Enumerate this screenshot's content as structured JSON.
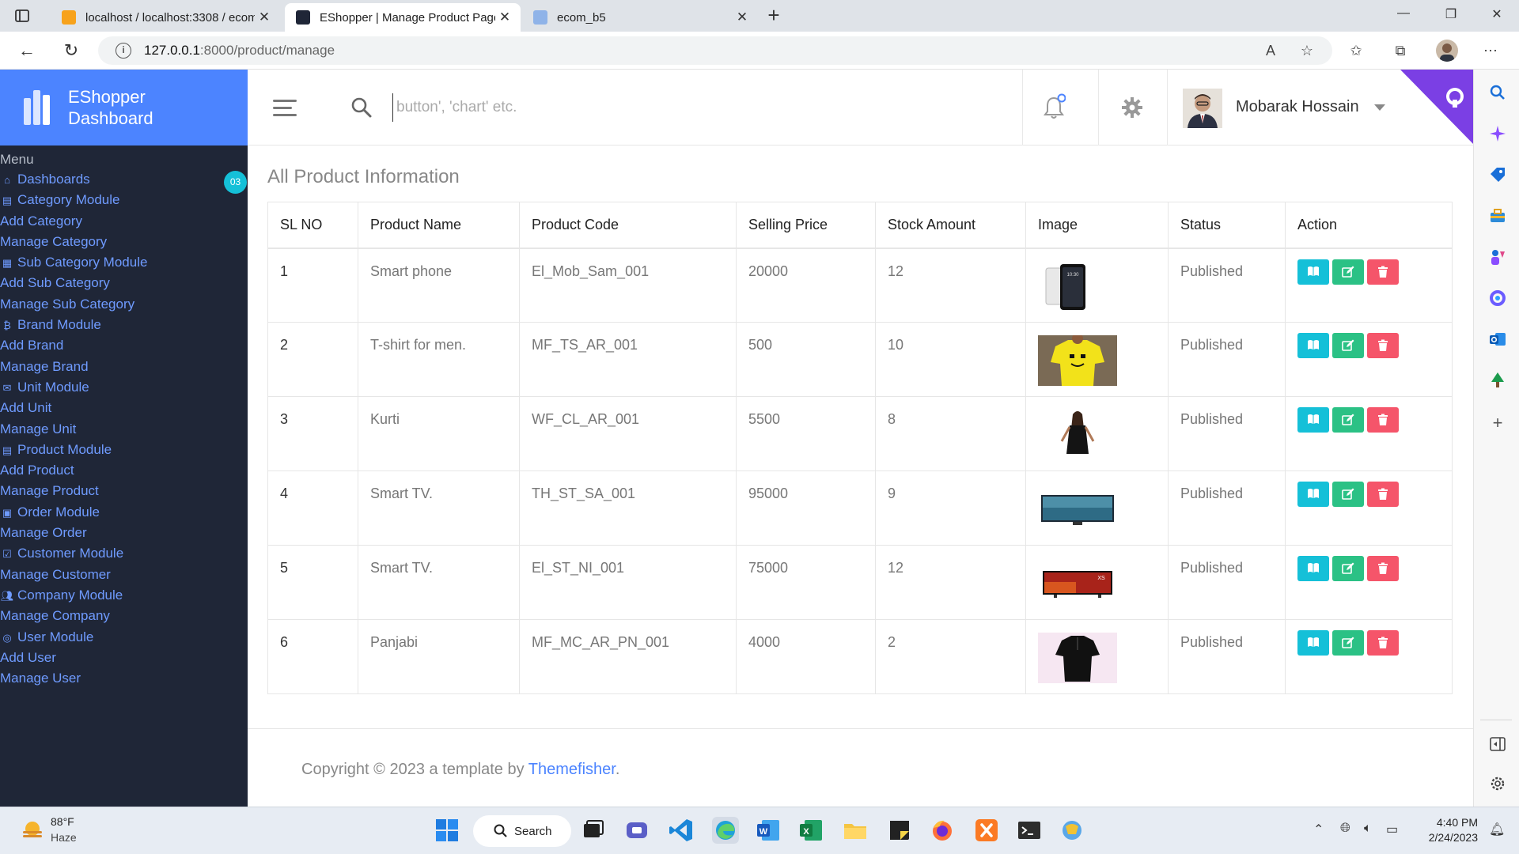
{
  "browser": {
    "tabs": [
      {
        "title": "localhost / localhost:3308 / ecom",
        "active": false
      },
      {
        "title": "EShopper | Manage Product Page",
        "active": true
      },
      {
        "title": "ecom_b5",
        "active": false
      }
    ],
    "url_host": "127.0.0.1",
    "url_path": ":8000/product/manage"
  },
  "sidebar": {
    "brand_line1": "EShopper",
    "brand_line2": "Dashboard",
    "menu_title": "Menu",
    "badge": "03",
    "items": [
      {
        "label": "Dashboards",
        "icon": "home-icon"
      },
      {
        "label": "Category Module",
        "icon": "grid-icon"
      },
      {
        "label": "Add Category",
        "icon": ""
      },
      {
        "label": "Manage Category",
        "icon": ""
      },
      {
        "label": "Sub Category Module",
        "icon": "apps-icon"
      },
      {
        "label": "Add Sub Category",
        "icon": ""
      },
      {
        "label": "Manage Sub Category",
        "icon": ""
      },
      {
        "label": "Brand Module",
        "icon": "bitcoin-icon"
      },
      {
        "label": "Add Brand",
        "icon": ""
      },
      {
        "label": "Manage Brand",
        "icon": ""
      },
      {
        "label": "Unit Module",
        "icon": "mail-icon"
      },
      {
        "label": "Add Unit",
        "icon": ""
      },
      {
        "label": "Manage Unit",
        "icon": ""
      },
      {
        "label": "Product Module",
        "icon": "document-icon"
      },
      {
        "label": "Add Product",
        "icon": ""
      },
      {
        "label": "Manage Product",
        "icon": ""
      },
      {
        "label": "Order Module",
        "icon": "calendar-icon"
      },
      {
        "label": "Manage Order",
        "icon": ""
      },
      {
        "label": "Customer Module",
        "icon": "checklist-icon"
      },
      {
        "label": "Manage Customer",
        "icon": ""
      },
      {
        "label": "Company Module",
        "icon": "users-icon"
      },
      {
        "label": "Manage Company",
        "icon": ""
      },
      {
        "label": "User Module",
        "icon": "user-circle-icon"
      },
      {
        "label": "Add User",
        "icon": ""
      },
      {
        "label": "Manage User",
        "icon": ""
      }
    ]
  },
  "header": {
    "search_placeholder": "button', 'chart' etc.",
    "username": "Mobarak Hossain"
  },
  "main": {
    "title": "All Product Information",
    "columns": [
      "SL NO",
      "Product Name",
      "Product Code",
      "Selling Price",
      "Stock Amount",
      "Image",
      "Status",
      "Action"
    ],
    "rows": [
      {
        "sl": "1",
        "name": "Smart phone",
        "code": "El_Mob_Sam_001",
        "price": "20000",
        "stock": "12",
        "image": "phone-image",
        "status": "Published"
      },
      {
        "sl": "2",
        "name": "T-shirt for men.",
        "code": "MF_TS_AR_001",
        "price": "500",
        "stock": "10",
        "image": "tshirt-image",
        "status": "Published"
      },
      {
        "sl": "3",
        "name": "Kurti",
        "code": "WF_CL_AR_001",
        "price": "5500",
        "stock": "8",
        "image": "kurti-image",
        "status": "Published"
      },
      {
        "sl": "4",
        "name": "Smart TV.",
        "code": "TH_ST_SA_001",
        "price": "95000",
        "stock": "9",
        "image": "tv-image",
        "status": "Published"
      },
      {
        "sl": "5",
        "name": "Smart TV.",
        "code": "El_ST_NI_001",
        "price": "75000",
        "stock": "12",
        "image": "tv-red-image",
        "status": "Published"
      },
      {
        "sl": "6",
        "name": "Panjabi",
        "code": "MF_MC_AR_PN_001",
        "price": "4000",
        "stock": "2",
        "image": "panjabi-image",
        "status": "Published"
      }
    ]
  },
  "footer": {
    "text": "Copyright © 2023 a template by ",
    "link": "Themefisher",
    "end": "."
  },
  "taskbar": {
    "temperature": "88°F",
    "condition": "Haze",
    "search_label": "Search",
    "time": "4:40 PM",
    "date": "2/24/2023"
  },
  "colors": {
    "brand": "#4c84ff",
    "sidebar_bg": "#1f2637",
    "view_btn": "#15c0d8",
    "edit_btn": "#2bc185",
    "delete_btn": "#f5556a"
  }
}
